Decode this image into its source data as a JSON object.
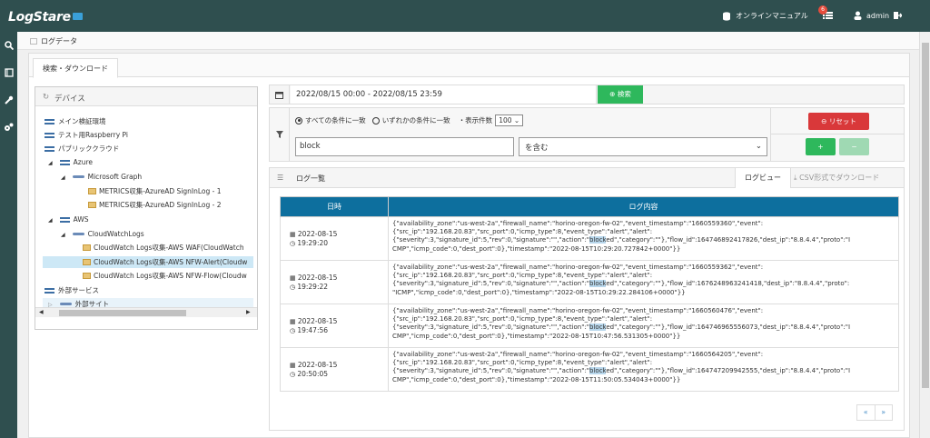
{
  "app": {
    "logo": "LogStare"
  },
  "topnav": {
    "manual": "オンラインマニュアル",
    "badge_count": "6",
    "user": "admin"
  },
  "breadcrumb": "ログデータ",
  "tabs": {
    "active": "検索・ダウンロード"
  },
  "devices": {
    "title": "デバイス",
    "items": [
      {
        "label": "メイン検証環境"
      },
      {
        "label": "テスト用Raspberry Pi"
      },
      {
        "label": "パブリッククラウド"
      },
      {
        "label": "Azure"
      },
      {
        "label": "Microsoft Graph"
      },
      {
        "label": "METRICS収集-AzureAD SignInLog - 1"
      },
      {
        "label": "METRICS収集-AzureAD SignInLog - 2"
      },
      {
        "label": "AWS"
      },
      {
        "label": "CloudWatchLogs"
      },
      {
        "label": "CloudWatch Logs収集-AWS WAF(CloudWatch"
      },
      {
        "label": "CloudWatch Logs収集-AWS NFW-Alert(Cloudw"
      },
      {
        "label": "CloudWatch Logs収集-AWS NFW-Flow(Cloudw"
      },
      {
        "label": "外部サービス"
      },
      {
        "label": "外部サイト"
      }
    ]
  },
  "search": {
    "date_range": "2022/08/15 00:00 - 2022/08/15 23:59",
    "search_button": "検索",
    "reset_button": "リセット",
    "opt_all": "すべての条件に一致",
    "opt_any": "いずれかの条件に一致",
    "count_label": "・表示件数",
    "count_value": "100",
    "keyword": "block",
    "operator": "を含む",
    "plus": "+",
    "minus": "−"
  },
  "log": {
    "title": "ログ一覧",
    "tab_view": "ログビュー",
    "tab_csv": "CSV形式でダウンロード",
    "col_date": "日時",
    "col_content": "ログ内容",
    "rows": [
      {
        "date": "2022-08-15",
        "time": "19:29:20",
        "l1": "{\"availability_zone\":\"us-west-2a\",\"firewall_name\":\"horino-oregon-fw-02\",\"event_timestamp\":\"1660559360\",\"event\":",
        "l2": "{\"src_ip\":\"192.168.20.83\",\"src_port\":0,\"icmp_type\":8,\"event_type\":\"alert\",\"alert\":",
        "l3a": "{\"severity\":3,\"signature_id\":5,\"rev\":0,\"signature\":\"\",\"action\":\"",
        "hl": "block",
        "l3b": "ed\",\"category\":\"\"},\"flow_id\":164746892417826,\"dest_ip\":\"8.8.4.4\",\"proto\":\"I",
        "l4": "CMP\",\"icmp_code\":0,\"dest_port\":0},\"timestamp\":\"2022-08-15T10:29:20.727842+0000\"}}"
      },
      {
        "date": "2022-08-15",
        "time": "19:29:22",
        "l1": "{\"availability_zone\":\"us-west-2a\",\"firewall_name\":\"horino-oregon-fw-02\",\"event_timestamp\":\"1660559362\",\"event\":",
        "l2": "{\"src_ip\":\"192.168.20.83\",\"src_port\":0,\"icmp_type\":8,\"event_type\":\"alert\",\"alert\":",
        "l3a": "{\"severity\":3,\"signature_id\":5,\"rev\":0,\"signature\":\"\",\"action\":\"",
        "hl": "block",
        "l3b": "ed\",\"category\":\"\"},\"flow_id\":1676248963241418,\"dest_ip\":\"8.8.4.4\",\"proto\":",
        "l4": "\"ICMP\",\"icmp_code\":0,\"dest_port\":0},\"timestamp\":\"2022-08-15T10:29:22.284106+0000\"}}"
      },
      {
        "date": "2022-08-15",
        "time": "19:47:56",
        "l1": "{\"availability_zone\":\"us-west-2a\",\"firewall_name\":\"horino-oregon-fw-02\",\"event_timestamp\":\"1660560476\",\"event\":",
        "l2": "{\"src_ip\":\"192.168.20.83\",\"src_port\":0,\"icmp_type\":8,\"event_type\":\"alert\",\"alert\":",
        "l3a": "{\"severity\":3,\"signature_id\":5,\"rev\":0,\"signature\":\"\",\"action\":\"",
        "hl": "block",
        "l3b": "ed\",\"category\":\"\"},\"flow_id\":164746965556073,\"dest_ip\":\"8.8.4.4\",\"proto\":\"I",
        "l4": "CMP\",\"icmp_code\":0,\"dest_port\":0},\"timestamp\":\"2022-08-15T10:47:56.531305+0000\"}}"
      },
      {
        "date": "2022-08-15",
        "time": "20:50:05",
        "l1": "{\"availability_zone\":\"us-west-2a\",\"firewall_name\":\"horino-oregon-fw-02\",\"event_timestamp\":\"1660564205\",\"event\":",
        "l2": "{\"src_ip\":\"192.168.20.83\",\"src_port\":0,\"icmp_type\":8,\"event_type\":\"alert\",\"alert\":",
        "l3a": "{\"severity\":3,\"signature_id\":5,\"rev\":0,\"signature\":\"\",\"action\":\"",
        "hl": "block",
        "l3b": "ed\",\"category\":\"\"},\"flow_id\":164747209942555,\"dest_ip\":\"8.8.4.4\",\"proto\":\"I",
        "l4": "CMP\",\"icmp_code\":0,\"dest_port\":0},\"timestamp\":\"2022-08-15T11:50:05.534043+0000\"}}"
      }
    ]
  },
  "pager": {
    "prev": "«",
    "next": "»"
  },
  "colors": {
    "topbar": "#2f4f4f",
    "table_header": "#0d6f9e",
    "search_green": "#2eb85c",
    "reset_red": "#d9383a"
  }
}
